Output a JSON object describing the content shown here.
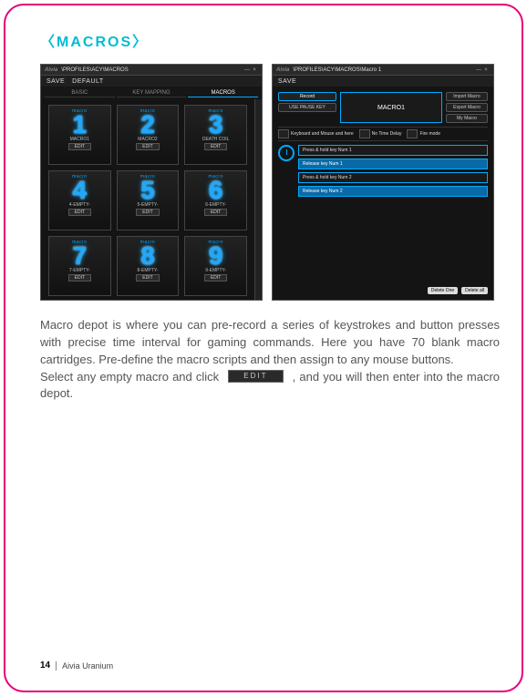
{
  "title": "〈MACROS〉",
  "left_window": {
    "logo": "Aivia",
    "path": "\\PROFILES\\ACY\\MACROS",
    "menu": {
      "save": "SAVE",
      "default": "DEFAULT"
    },
    "tabs": {
      "basic": "BASIC",
      "keymapping": "KEY MAPPING",
      "macros": "MACROS"
    },
    "macro_top_label": "macro",
    "macros": [
      {
        "num": "1",
        "name": "MACRO1",
        "edit": "EDIT"
      },
      {
        "num": "2",
        "name": "MACRO2",
        "edit": "EDIT"
      },
      {
        "num": "3",
        "name": "DEATH COIL",
        "edit": "EDIT"
      },
      {
        "num": "4",
        "name": "4-EMPTY-",
        "edit": "EDIT"
      },
      {
        "num": "5",
        "name": "5-EMPTY-",
        "edit": "EDIT"
      },
      {
        "num": "6",
        "name": "6-EMPTY-",
        "edit": "EDIT"
      },
      {
        "num": "7",
        "name": "7-EMPTY-",
        "edit": "EDIT"
      },
      {
        "num": "8",
        "name": "8-EMPTY-",
        "edit": "EDIT"
      },
      {
        "num": "9",
        "name": "9-EMPTY-",
        "edit": "EDIT"
      }
    ]
  },
  "right_window": {
    "logo": "Aivia",
    "path": "\\PROFILES\\ACY\\MACROS\\Macro 1",
    "menu": {
      "save": "SAVE"
    },
    "record": "Record",
    "usepause": "USE PAUSE KEY",
    "macro_name": "MACRO1",
    "side": {
      "import": "Import Macro",
      "export": "Export Macro",
      "my": "My Macro"
    },
    "mid": {
      "kbm": "Keyboard and Mouse and here",
      "ntd": "No Time Delay",
      "fire": "Fire mode"
    },
    "steps": [
      "Press & hold key Num 1",
      "Release key Num 1",
      "Press & hold key Num 2",
      "Release key Num 2"
    ],
    "delete_one": "Delete One",
    "delete_all": "Delete all"
  },
  "body": {
    "p1": "Macro depot is where you can pre-record a series of keystrokes and button presses with precise time interval for gaming commands. Here you have 70 blank macro cartridges. Pre-define the macro scripts and then assign to any mouse buttons.",
    "p2a": "Select any empty macro and click ",
    "edit_btn": "EDIT",
    "p2b": " , and you will then enter into the macro depot."
  },
  "footer": {
    "page": "14",
    "product": "Aivia Uranium"
  }
}
